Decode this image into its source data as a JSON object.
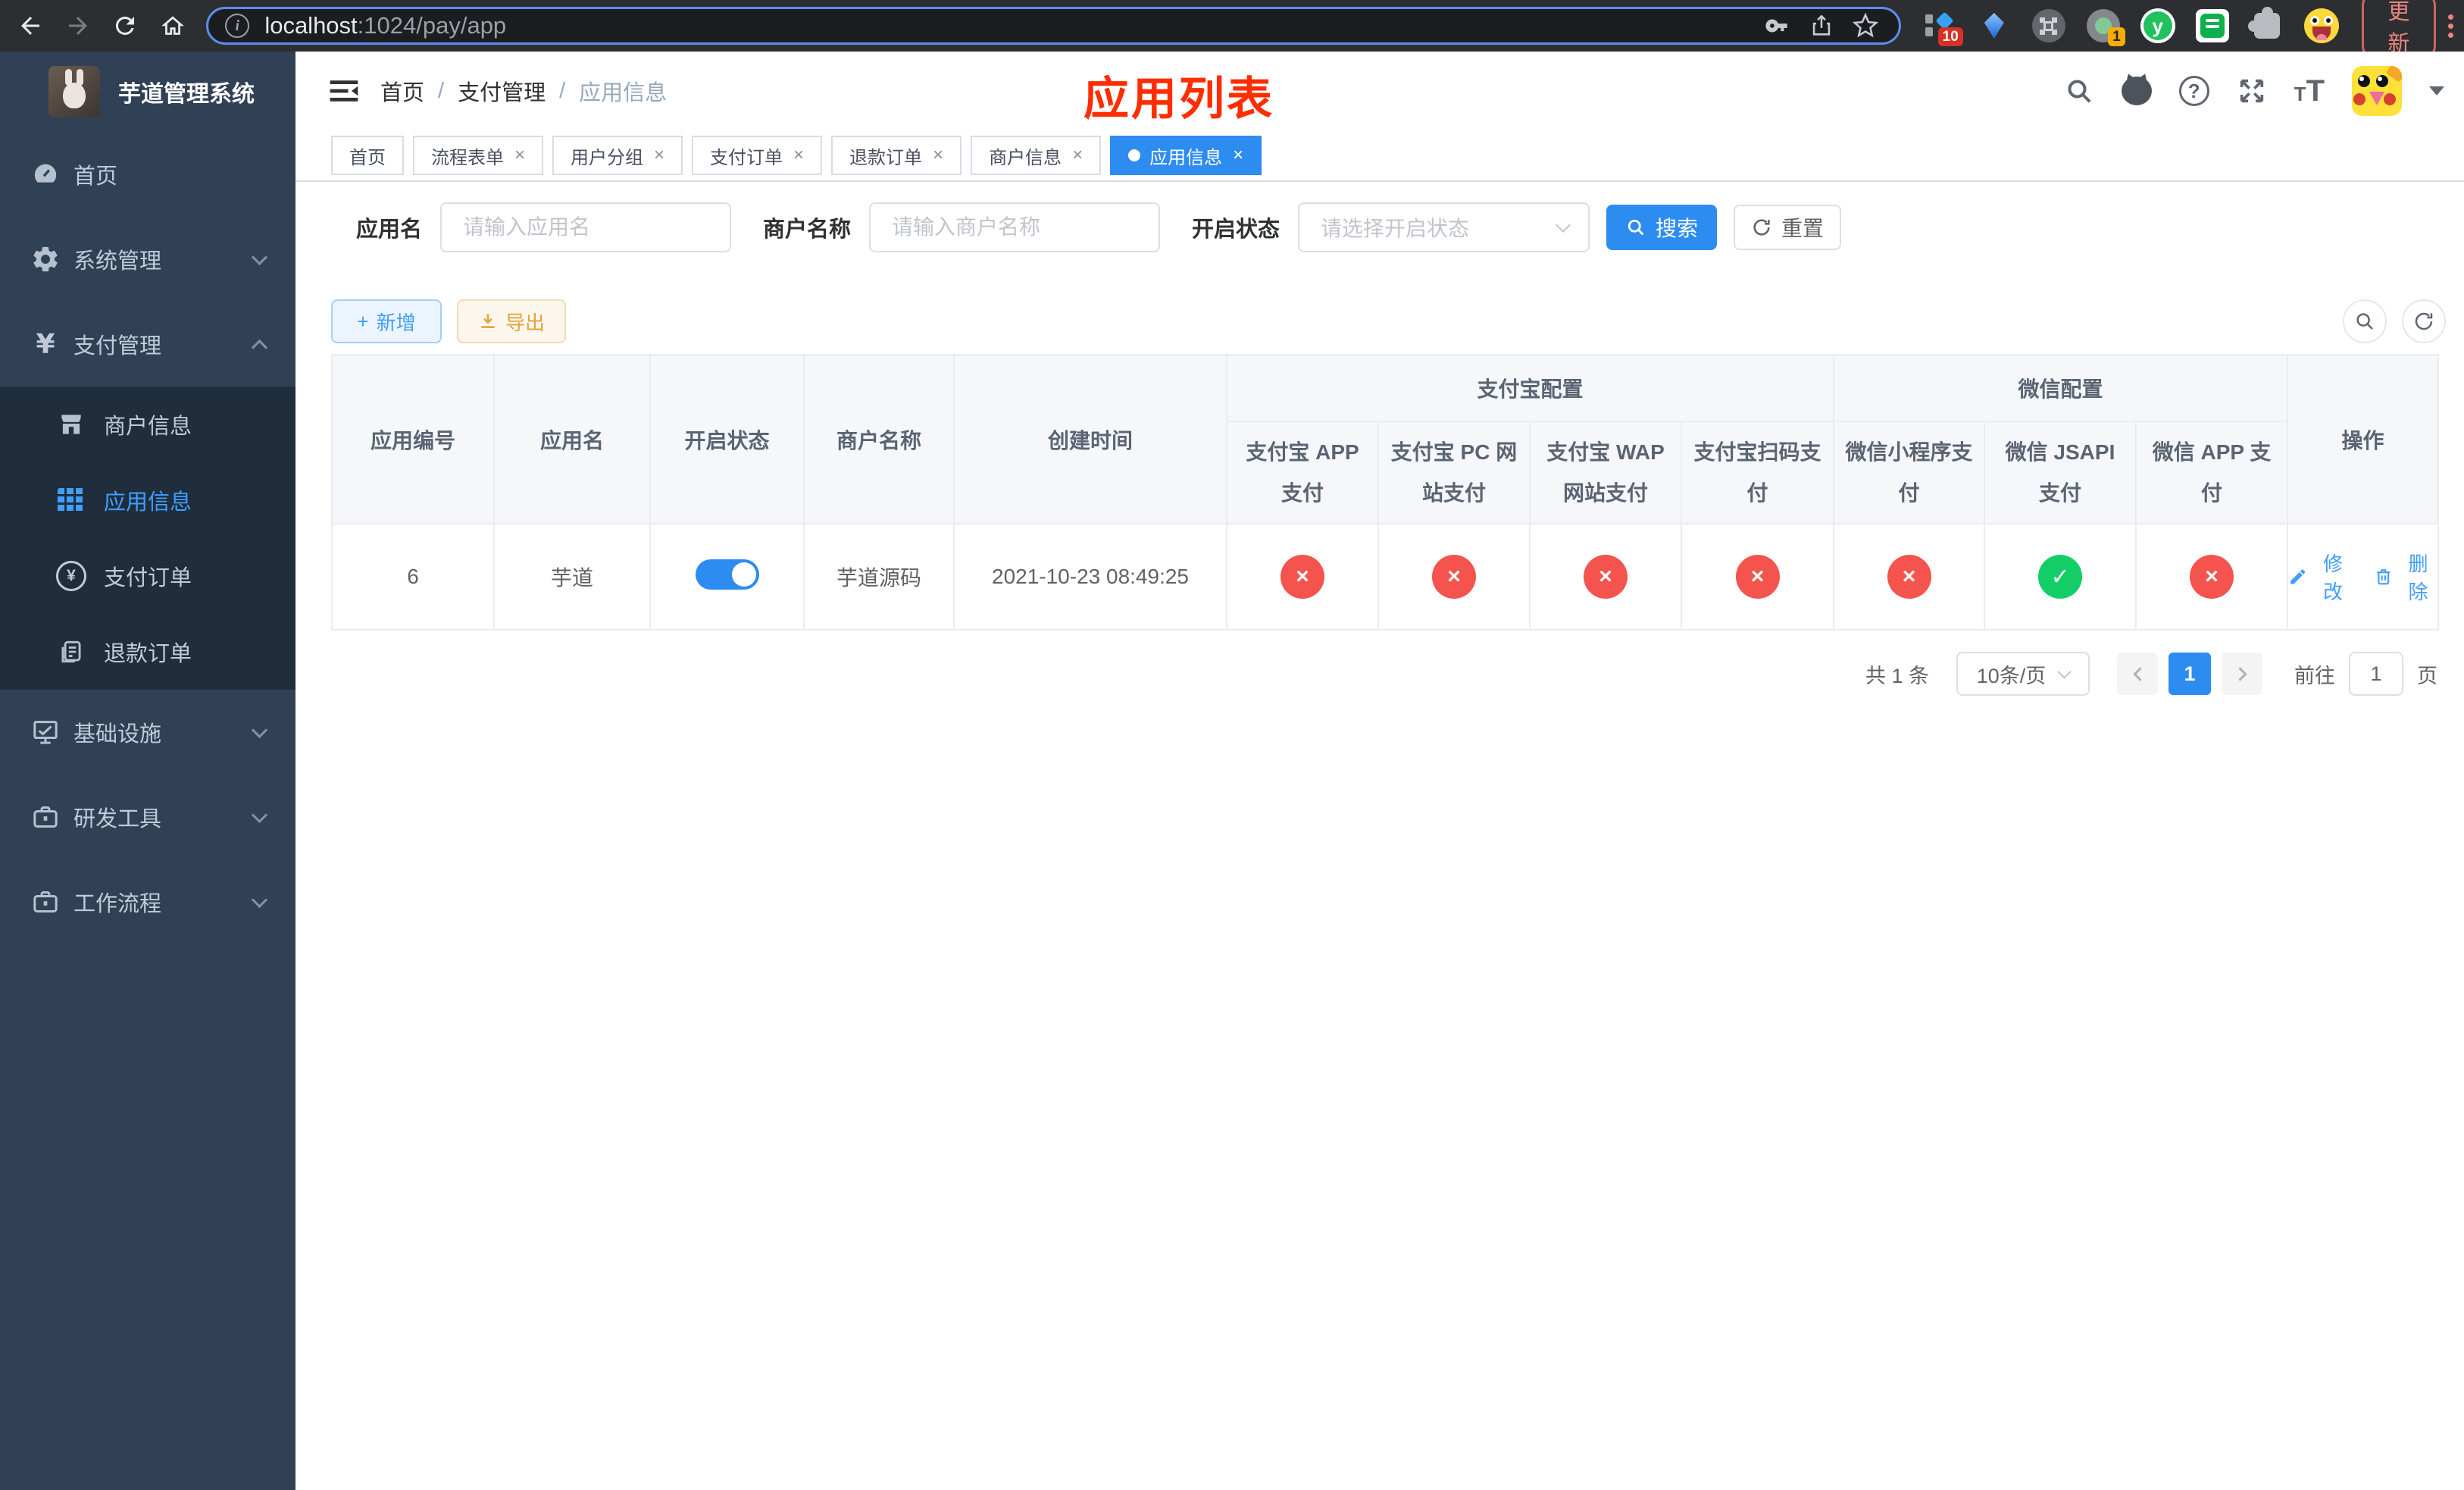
{
  "browser": {
    "host": "localhost",
    "path": ":1024/pay/app",
    "update_label": "更新",
    "ext_badge_docs": "10",
    "ext_badge_recorder": "1",
    "ext_letter": "y"
  },
  "colors": {
    "accent": "#2d8cf0",
    "link": "#409eff",
    "danger": "#f5534d",
    "success": "#13ce66",
    "warning": "#e6a23c",
    "annotation": "#ff2d00",
    "sidebar_bg": "#304156",
    "submenu_bg": "#1f2d3d"
  },
  "sidebar": {
    "title": "芋道管理系统",
    "items": [
      {
        "label": "首页"
      },
      {
        "label": "系统管理"
      },
      {
        "label": "支付管理"
      },
      {
        "label": "商户信息"
      },
      {
        "label": "应用信息"
      },
      {
        "label": "支付订单"
      },
      {
        "label": "退款订单"
      },
      {
        "label": "基础设施"
      },
      {
        "label": "研发工具"
      },
      {
        "label": "工作流程"
      }
    ]
  },
  "header": {
    "breadcrumb": [
      {
        "label": "首页"
      },
      {
        "label": "支付管理"
      },
      {
        "label": "应用信息"
      }
    ],
    "separator": "/",
    "annotation": "应用列表"
  },
  "tabs": [
    {
      "label": "首页"
    },
    {
      "label": "流程表单"
    },
    {
      "label": "用户分组"
    },
    {
      "label": "支付订单"
    },
    {
      "label": "退款订单"
    },
    {
      "label": "商户信息"
    },
    {
      "label": "应用信息"
    }
  ],
  "filters": {
    "app_name_label": "应用名",
    "app_name_placeholder": "请输入应用名",
    "merchant_label": "商户名称",
    "merchant_placeholder": "请输入商户名称",
    "status_label": "开启状态",
    "status_placeholder": "请选择开启状态",
    "search_label": "搜索",
    "reset_label": "重置"
  },
  "toolbar": {
    "add_label": "新增",
    "export_label": "导出"
  },
  "table": {
    "group_alipay": "支付宝配置",
    "group_wechat": "微信配置",
    "columns": [
      "应用编号",
      "应用名",
      "开启状态",
      "商户名称",
      "创建时间",
      "支付宝 APP 支付",
      "支付宝 PC 网站支付",
      "支付宝 WAP 网站支付",
      "支付宝扫码支付",
      "微信小程序支付",
      "微信 JSAPI 支付",
      "微信 APP 支付",
      "操作"
    ],
    "row": {
      "id": "6",
      "name": "芋道",
      "enabled": true,
      "merchant": "芋道源码",
      "created_at": "2021-10-23 08:49:25",
      "channels": {
        "alipay_app": false,
        "alipay_pc": false,
        "alipay_wap": false,
        "alipay_qr": false,
        "wechat_lite": false,
        "wechat_jsapi": true,
        "wechat_app": false
      },
      "edit_label": "修改",
      "delete_label": "删除"
    }
  },
  "pagination": {
    "total_label": "共 1 条",
    "page_size_label": "10条/页",
    "page": "1",
    "goto_label": "前往",
    "goto_value": "1",
    "unit_label": "页"
  },
  "icons": {
    "close": "×",
    "cross": "×",
    "check": "✓",
    "plus": "+",
    "yen": "¥",
    "question": "?"
  }
}
